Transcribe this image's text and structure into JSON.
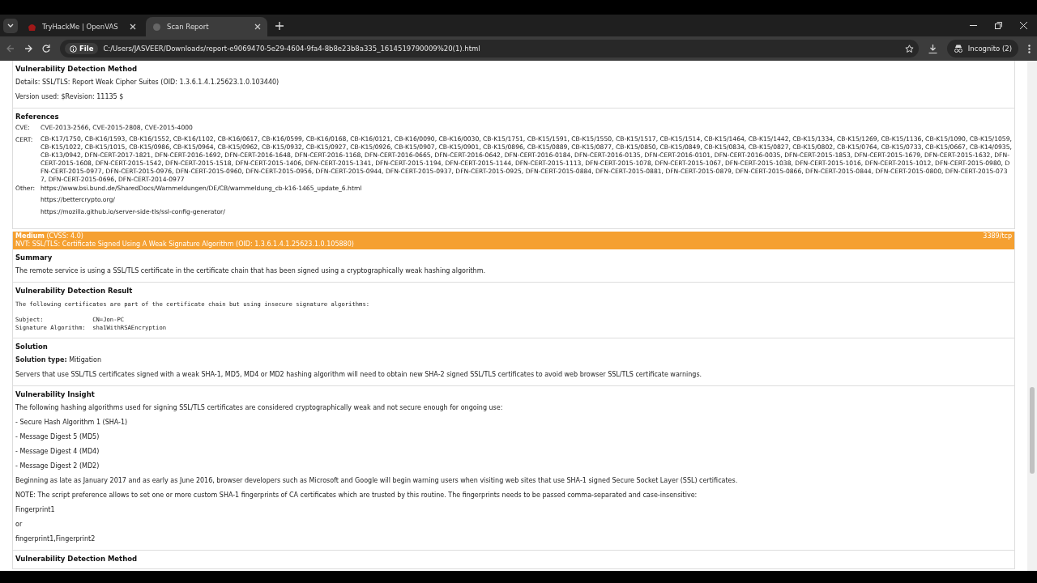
{
  "browser": {
    "tabs": [
      {
        "title": "TryHackMe | OpenVAS",
        "selected": false
      },
      {
        "title": "Scan Report",
        "selected": true
      }
    ],
    "address": {
      "scheme": "File",
      "url": "C:/Users/JASVEER/Downloads/report-e9069470-5e29-4604-9fa4-8b8e23b8a335_1614519790009%20(1).html"
    },
    "profile": "Incognito (2)"
  },
  "previous_result": {
    "sections": [
      {
        "heading": "Vulnerability Detection Method",
        "blocks": [
          {
            "kind": "text",
            "text": "Details: SSL/TLS: Report Weak Cipher Suites (OID: 1.3.6.1.4.1.25623.1.0.103440)"
          },
          {
            "kind": "text",
            "text": "Version used: $Revision: 11135 $"
          }
        ]
      }
    ],
    "references": {
      "heading": "References",
      "rows": [
        {
          "label": "CVE:",
          "values": [
            "CVE-2013-2566, CVE-2015-2808, CVE-2015-4000"
          ]
        },
        {
          "label": "CERT:",
          "values": [
            "CB-K17/1750, CB-K16/1593, CB-K16/1552, CB-K16/1102, CB-K16/0617, CB-K16/0599, CB-K16/0168, CB-K16/0121, CB-K16/0090, CB-K16/0030, CB-K15/1751, CB-K15/1591, CB-K15/1550, CB-K15/1517, CB-K15/1514, CB-K15/1464, CB-K15/1442, CB-K15/1334, CB-K15/1269, CB-K15/1136, CB-K15/1090, CB-K15/1059, CB-K15/1022, CB-K15/1015, CB-K15/0986, CB-K15/0964, CB-K15/0962, CB-K15/0932, CB-K15/0927, CB-K15/0926, CB-K15/0907, CB-K15/0901, CB-K15/0896, CB-K15/0889, CB-K15/0877, CB-K15/0850, CB-K15/0849, CB-K15/0834, CB-K15/0827, CB-K15/0802, CB-K15/0764, CB-K15/0733, CB-K15/0667, CB-K14/0935, CB-K13/0942, DFN-CERT-2017-1821, DFN-CERT-2016-1692, DFN-CERT-2016-1648, DFN-CERT-2016-1168, DFN-CERT-2016-0665, DFN-CERT-2016-0642, DFN-CERT-2016-0184, DFN-CERT-2016-0135, DFN-CERT-2016-0101, DFN-CERT-2016-0035, DFN-CERT-2015-1853, DFN-CERT-2015-1679, DFN-CERT-2015-1632, DFN-CERT-2015-1608, DFN-CERT-2015-1542, DFN-CERT-2015-1518, DFN-CERT-2015-1406, DFN-CERT-2015-1341, DFN-CERT-2015-1194, DFN-CERT-2015-1144, DFN-CERT-2015-1113, DFN-CERT-2015-1078, DFN-CERT-2015-1067, DFN-CERT-2015-1038, DFN-CERT-2015-1016, DFN-CERT-2015-1012, DFN-CERT-2015-0980, DFN-CERT-2015-0977, DFN-CERT-2015-0976, DFN-CERT-2015-0960, DFN-CERT-2015-0956, DFN-CERT-2015-0944, DFN-CERT-2015-0937, DFN-CERT-2015-0925, DFN-CERT-2015-0884, DFN-CERT-2015-0881, DFN-CERT-2015-0879, DFN-CERT-2015-0866, DFN-CERT-2015-0844, DFN-CERT-2015-0800, DFN-CERT-2015-0737, DFN-CERT-2015-0696, DFN-CERT-2014-0977"
          ]
        },
        {
          "label": "Other:",
          "values": [
            "https://www.bsi.bund.de/SharedDocs/Warnmeldungen/DE/CB/warnmeldung_cb-k16-1465_update_6.html",
            "https://bettercrypto.org/",
            "https://mozilla.github.io/server-side-tls/ssl-config-generator/"
          ]
        }
      ]
    }
  },
  "result": {
    "severity": "Medium",
    "cvss": "(CVSS: 4.0)",
    "nvt": "NVT: SSL/TLS: Certificate Signed Using A Weak Signature Algorithm (OID: 1.3.6.1.4.1.25623.1.0.105880)",
    "port": "3389/tcp",
    "sections": [
      {
        "heading": "Summary",
        "blocks": [
          {
            "kind": "text",
            "text": "The remote service is using a SSL/TLS certificate in the certificate chain that has been signed using a cryptographically weak hashing algorithm."
          }
        ]
      },
      {
        "heading": "Vulnerability Detection Result",
        "blocks": [
          {
            "kind": "pre",
            "text": "The following certificates are part of the certificate chain but using insecure signature algorithms:\n\nSubject:              CN=Jon-PC\nSignature Algorithm:  sha1WithRSAEncryption"
          }
        ]
      },
      {
        "heading": "Solution",
        "blocks": [
          {
            "kind": "text",
            "text": "**Solution type:** Mitigation"
          },
          {
            "kind": "text",
            "text": "Servers that use SSL/TLS certificates signed with a weak SHA-1, MD5, MD4 or MD2 hashing algorithm will need to obtain new SHA-2 signed SSL/TLS certificates to avoid web browser SSL/TLS certificate warnings."
          }
        ]
      },
      {
        "heading": "Vulnerability Insight",
        "blocks": [
          {
            "kind": "text",
            "text": "The following hashing algorithms used for signing SSL/TLS certificates are considered cryptographically weak and not secure enough for ongoing use:"
          },
          {
            "kind": "text",
            "text": "- Secure Hash Algorithm 1 (SHA-1)"
          },
          {
            "kind": "text",
            "text": "- Message Digest 5 (MD5)"
          },
          {
            "kind": "text",
            "text": "- Message Digest 4 (MD4)"
          },
          {
            "kind": "text",
            "text": "- Message Digest 2 (MD2)"
          },
          {
            "kind": "text",
            "text": "Beginning as late as January 2017 and as early as June 2016, browser developers such as Microsoft and Google will begin warning users when visiting web sites that use SHA-1 signed Secure Socket Layer (SSL) certificates."
          },
          {
            "kind": "text",
            "text": "NOTE: The script preference allows to set one or more custom SHA-1 fingerprints of CA certificates which are trusted by this routine. The fingerprints needs to be passed comma-separated and case-insensitive:"
          },
          {
            "kind": "text",
            "text": "Fingerprint1"
          },
          {
            "kind": "text",
            "text": "or"
          },
          {
            "kind": "text",
            "text": "fingerprint1,Fingerprint2"
          }
        ]
      },
      {
        "heading": "Vulnerability Detection Method"
      }
    ]
  }
}
